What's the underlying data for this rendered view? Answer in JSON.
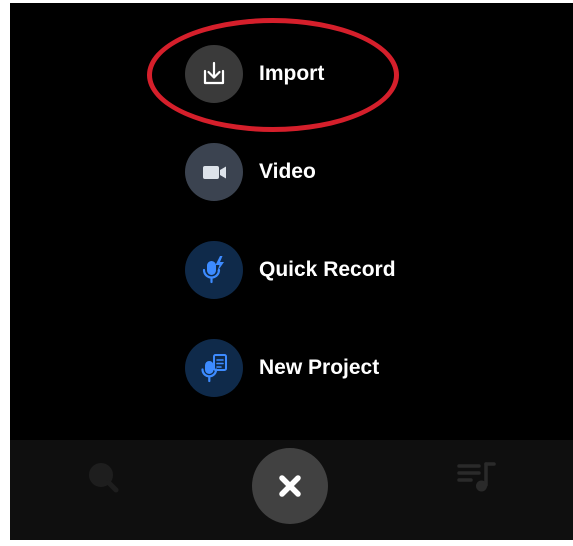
{
  "menu": {
    "items": [
      {
        "label": "Import",
        "icon": "download-icon",
        "icon_bg": "#3a3a3a"
      },
      {
        "label": "Video",
        "icon": "video-camera-icon",
        "icon_bg": "#3b4350"
      },
      {
        "label": "Quick Record",
        "icon": "mic-lightning-icon",
        "icon_bg": "#0f2a4a"
      },
      {
        "label": "New Project",
        "icon": "mic-document-icon",
        "icon_bg": "#0f2a4a"
      }
    ],
    "highlighted_item": "Import",
    "highlight_color": "#d51f2b"
  },
  "bottom_nav": {
    "left_icon": "search-icon",
    "center_icon": "close-icon",
    "right_icon": "playlist-icon"
  },
  "colors": {
    "background": "#000000",
    "accent_blue": "#3d8bff",
    "close_button_bg": "#414141"
  }
}
